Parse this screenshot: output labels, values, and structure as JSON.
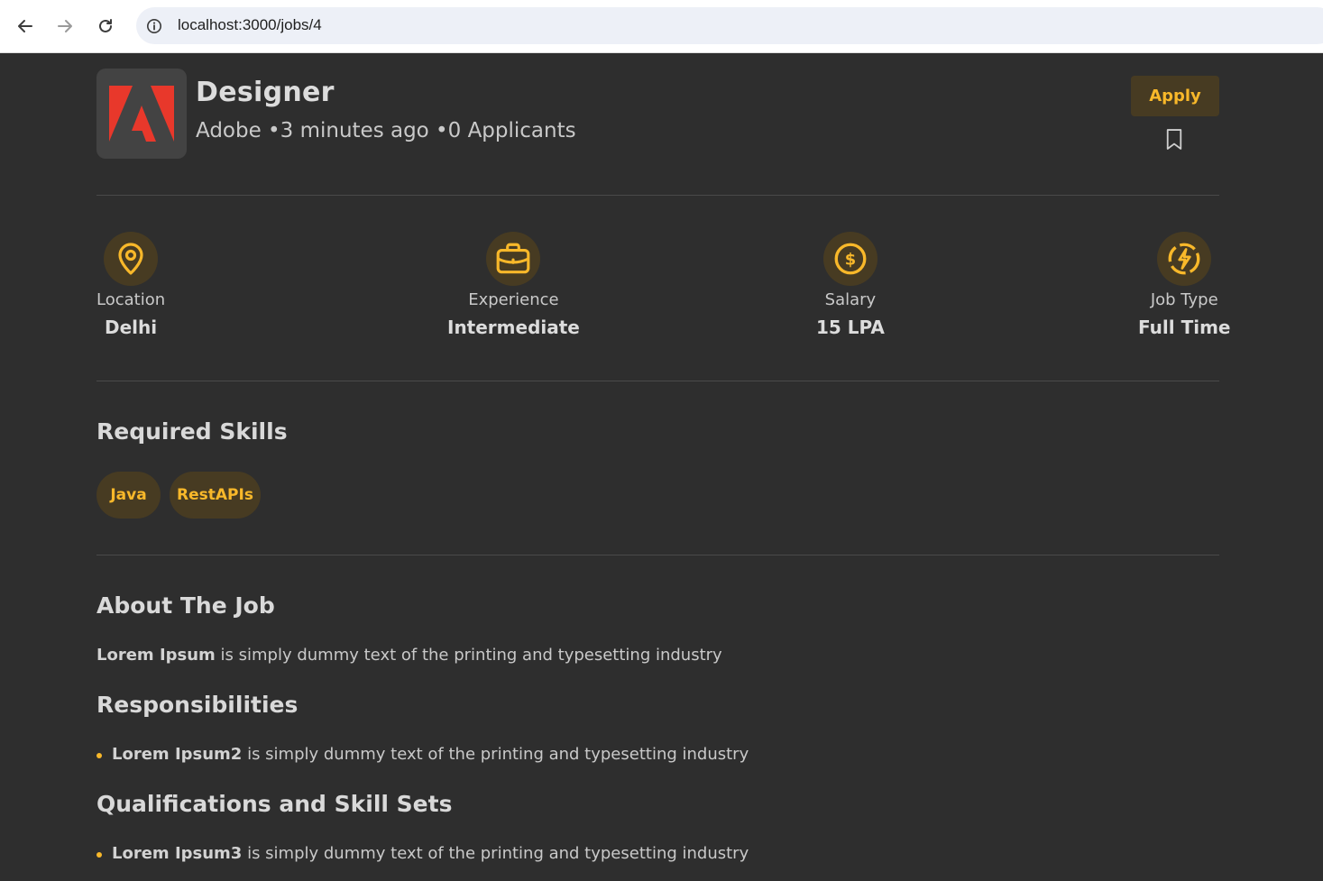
{
  "browser": {
    "url": "localhost:3000/jobs/4"
  },
  "job": {
    "company_logo": "adobe-logo",
    "title": "Designer",
    "company": "Adobe",
    "posted": "3 minutes ago",
    "applicants": "0 Applicants",
    "subtitle": "Adobe •3 minutes ago •0 Applicants",
    "apply_label": "Apply"
  },
  "stats": [
    {
      "icon": "location-pin-icon",
      "label": "Location",
      "value": "Delhi"
    },
    {
      "icon": "briefcase-icon",
      "label": "Experience",
      "value": "Intermediate"
    },
    {
      "icon": "dollar-icon",
      "label": "Salary",
      "value": "15 LPA"
    },
    {
      "icon": "lightning-icon",
      "label": "Job Type",
      "value": "Full Time"
    }
  ],
  "skills": {
    "heading": "Required Skills",
    "items": [
      "Java",
      "RestAPIs"
    ]
  },
  "about": {
    "heading": "About The Job",
    "bold": "Lorem Ipsum",
    "text": " is simply dummy text of the printing and typesetting industry"
  },
  "responsibilities": {
    "heading": "Responsibilities",
    "items": [
      {
        "bold": "Lorem Ipsum2",
        "text": " is simply dummy text of the printing and typesetting industry"
      }
    ]
  },
  "qualifications": {
    "heading": "Qualifications and Skill Sets",
    "items": [
      {
        "bold": "Lorem Ipsum3",
        "text": " is simply dummy text of the printing and typesetting industry"
      }
    ]
  },
  "colors": {
    "background": "#2e2e2e",
    "accent": "#f8b82a",
    "accent_bg": "#473b22",
    "adobe_red": "#e8382b"
  }
}
